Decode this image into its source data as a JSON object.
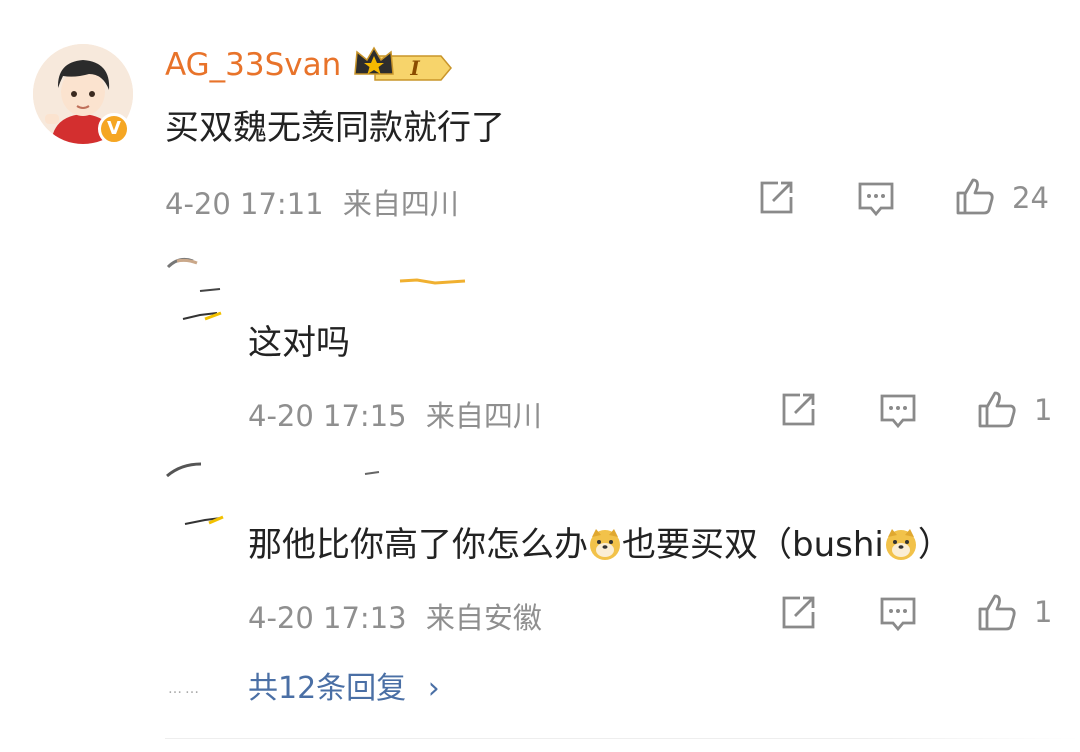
{
  "comment": {
    "username": "AG_33Svan",
    "level_badge": "I",
    "verified_badge": "V",
    "text": "买双魏无羡同款就行了",
    "timestamp": "4-20 17:11",
    "location": "来自四川",
    "like_count": "24"
  },
  "replies": [
    {
      "text": "这对吗",
      "timestamp": "4-20 17:15",
      "location": "来自四川",
      "like_count": "1"
    },
    {
      "text_parts": [
        "那他比你高了你怎么办",
        "也要买双（bushi",
        "）"
      ],
      "timestamp": "4-20 17:13",
      "location": "来自安徽",
      "like_count": "1"
    }
  ],
  "more_replies": {
    "dots": "……",
    "label": "共12条回复",
    "arrow": "›"
  },
  "icons": {
    "share": "share-icon",
    "reply": "comment-icon",
    "like": "thumbs-up-icon",
    "emoji": "doge-emoji"
  },
  "colors": {
    "username": "#e8732a",
    "link": "#4a6fa5",
    "meta": "#8f8f8f",
    "text": "#222222",
    "badge": "#f5a623"
  }
}
